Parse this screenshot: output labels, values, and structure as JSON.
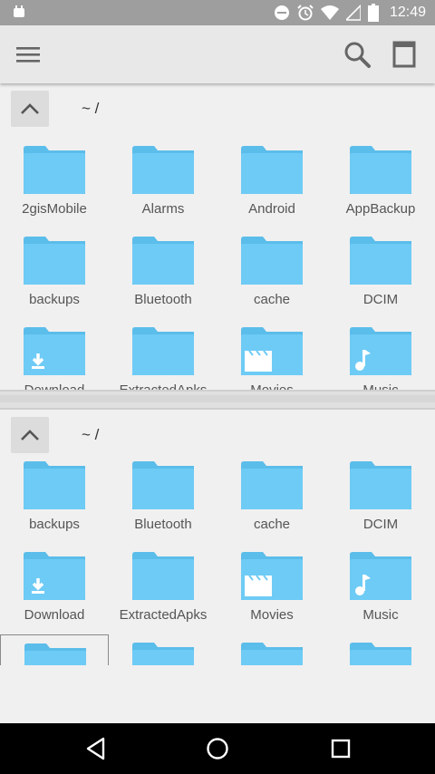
{
  "status_bar": {
    "time": "12:49",
    "icons": [
      "android-notification-icon",
      "dnd-icon",
      "alarm-icon",
      "wifi-icon",
      "signal-icon",
      "battery-icon"
    ]
  },
  "toolbar": {
    "icons": [
      "menu-icon",
      "search-icon",
      "dual-pane-icon"
    ]
  },
  "colors": {
    "folder": "#6ecbf5",
    "folder_tab": "#5bbdea",
    "status_bar": "#9e9e9e",
    "toolbar": "#e8e8e8",
    "nav_bar": "#000000"
  },
  "pane_top": {
    "path": "~ /",
    "items": [
      {
        "label": "2gisMobile",
        "icon": "folder"
      },
      {
        "label": "Alarms",
        "icon": "folder"
      },
      {
        "label": "Android",
        "icon": "folder"
      },
      {
        "label": "AppBackup",
        "icon": "folder"
      },
      {
        "label": "backups",
        "icon": "folder"
      },
      {
        "label": "Bluetooth",
        "icon": "folder"
      },
      {
        "label": "cache",
        "icon": "folder"
      },
      {
        "label": "DCIM",
        "icon": "folder"
      },
      {
        "label": "Download",
        "icon": "download"
      },
      {
        "label": "ExtractedApks",
        "icon": "folder"
      },
      {
        "label": "Movies",
        "icon": "movie"
      },
      {
        "label": "Music",
        "icon": "music"
      }
    ]
  },
  "pane_bottom": {
    "path": "~ /",
    "items": [
      {
        "label": "backups",
        "icon": "folder"
      },
      {
        "label": "Bluetooth",
        "icon": "folder"
      },
      {
        "label": "cache",
        "icon": "folder"
      },
      {
        "label": "DCIM",
        "icon": "folder"
      },
      {
        "label": "Download",
        "icon": "download"
      },
      {
        "label": "ExtractedApks",
        "icon": "folder"
      },
      {
        "label": "Movies",
        "icon": "movie"
      },
      {
        "label": "Music",
        "icon": "music"
      },
      {
        "label": "",
        "icon": "folder"
      },
      {
        "label": "",
        "icon": "folder"
      },
      {
        "label": "",
        "icon": "image"
      },
      {
        "label": "",
        "icon": "folder"
      }
    ]
  },
  "nav_bar": {
    "icons": [
      "back-icon",
      "home-icon",
      "recents-icon"
    ]
  }
}
